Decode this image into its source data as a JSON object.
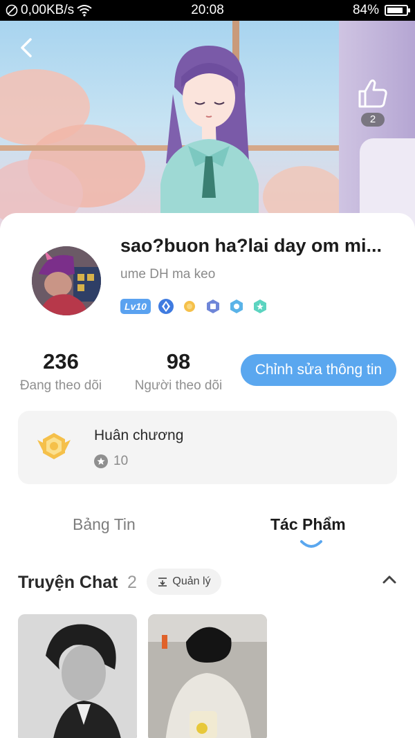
{
  "status_bar": {
    "network_speed": "0,00KB/s",
    "time": "20:08",
    "battery_percent": "84%",
    "battery_level": 0.84
  },
  "banner": {
    "like_count": "2"
  },
  "profile": {
    "name": "sao?buon ha?lai day om mi...",
    "subtitle": "ume DH ma keo",
    "level_badge": "Lv10",
    "badge_icons": [
      "diamond-icon",
      "coin-icon",
      "shield-badge-icon",
      "hexagon-badge-icon",
      "star-badge-icon"
    ]
  },
  "stats": {
    "following_count": "236",
    "following_label": "Đang theo dõi",
    "followers_count": "98",
    "followers_label": "Người theo dõi",
    "edit_button": "Chỉnh sửa thông tin"
  },
  "medal": {
    "title": "Huân chương",
    "count": "10"
  },
  "tabs": {
    "left": "Bảng Tin",
    "right": "Tác Phẩm",
    "active": "Tác Phẩm"
  },
  "section": {
    "title": "Truyện Chat",
    "count": "2",
    "manage_label": "Quản lý"
  },
  "colors": {
    "accent": "#5aa7ef",
    "level_badge": "#5aa2f0",
    "medal_gold": "#f5c04a"
  }
}
